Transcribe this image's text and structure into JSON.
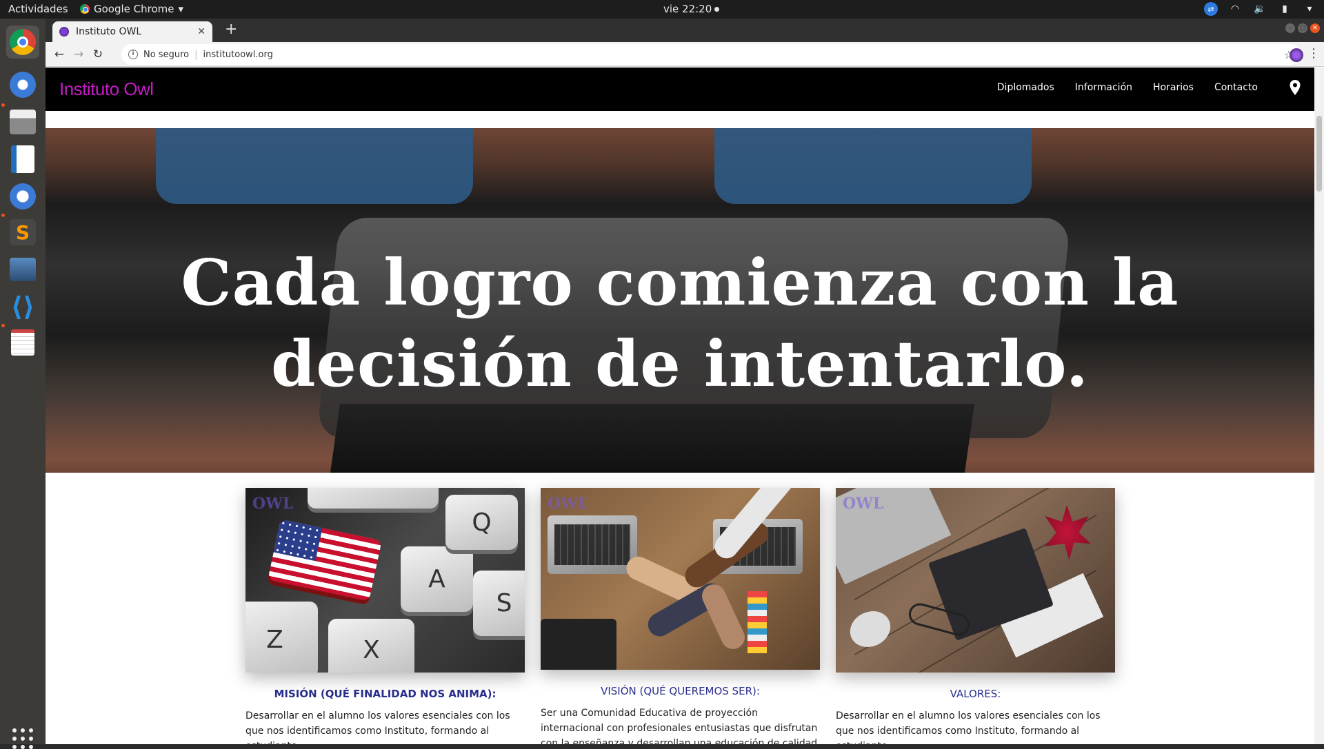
{
  "system": {
    "activities": "Actividades",
    "app_name": "Google Chrome",
    "clock": "vie 22:20"
  },
  "browser": {
    "tab_title": "Instituto OWL",
    "security_label": "No seguro",
    "url": "institutoowl.org"
  },
  "site": {
    "brand": "Instituto Owl",
    "menu": [
      "Diplomados",
      "Información",
      "Horarios",
      "Contacto"
    ],
    "hero_line1": "Cada logro comienza con la",
    "hero_line2": "decisión de intentarlo.",
    "cards": [
      {
        "title": "MISIÓN (QUÉ FINALIDAD NOS ANIMA):",
        "text": "Desarrollar en el alumno los valores esenciales con los que nos identificamos como Instituto, formando al estudiante"
      },
      {
        "title": "VISIÓN (QUÉ QUEREMOS SER):",
        "text": "Ser una Comunidad Educativa de proyección internacional con profesionales entusiastas que disfrutan con la enseñanza y desarrollan una educación de calidad"
      },
      {
        "title": "VALORES:",
        "text": "Desarrollar en el alumno los valores esenciales con los que nos identificamos como Instituto, formando al estudiante"
      }
    ],
    "watermark": "OWL"
  },
  "colors": {
    "brand": "#c61ac6",
    "card_title": "#2a2f8e",
    "navbar": "#000000"
  }
}
